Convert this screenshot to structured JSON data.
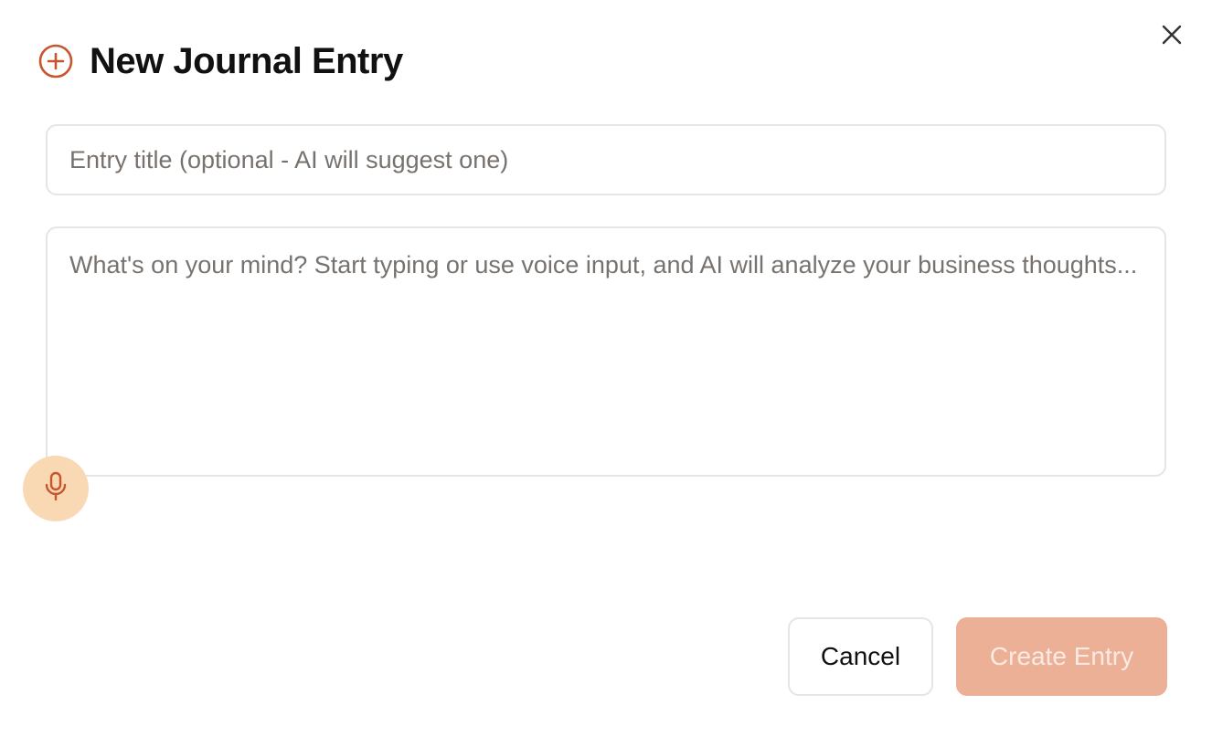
{
  "dialog": {
    "title": "New Journal Entry",
    "header_icon": "plus-circle-icon",
    "close_icon": "close-icon"
  },
  "form": {
    "title_placeholder": "Entry title (optional - AI will suggest one)",
    "title_value": "",
    "body_placeholder": "What's on your mind? Start typing or use voice input, and AI will analyze your business thoughts...",
    "body_value": "",
    "mic_icon": "microphone-icon"
  },
  "actions": {
    "cancel_label": "Cancel",
    "create_label": "Create Entry",
    "create_disabled": true
  },
  "colors": {
    "accent": "#c8552c",
    "mic_bg": "#f9d9b3",
    "create_bg_disabled": "#ecb096",
    "border": "#e7e5e3"
  }
}
